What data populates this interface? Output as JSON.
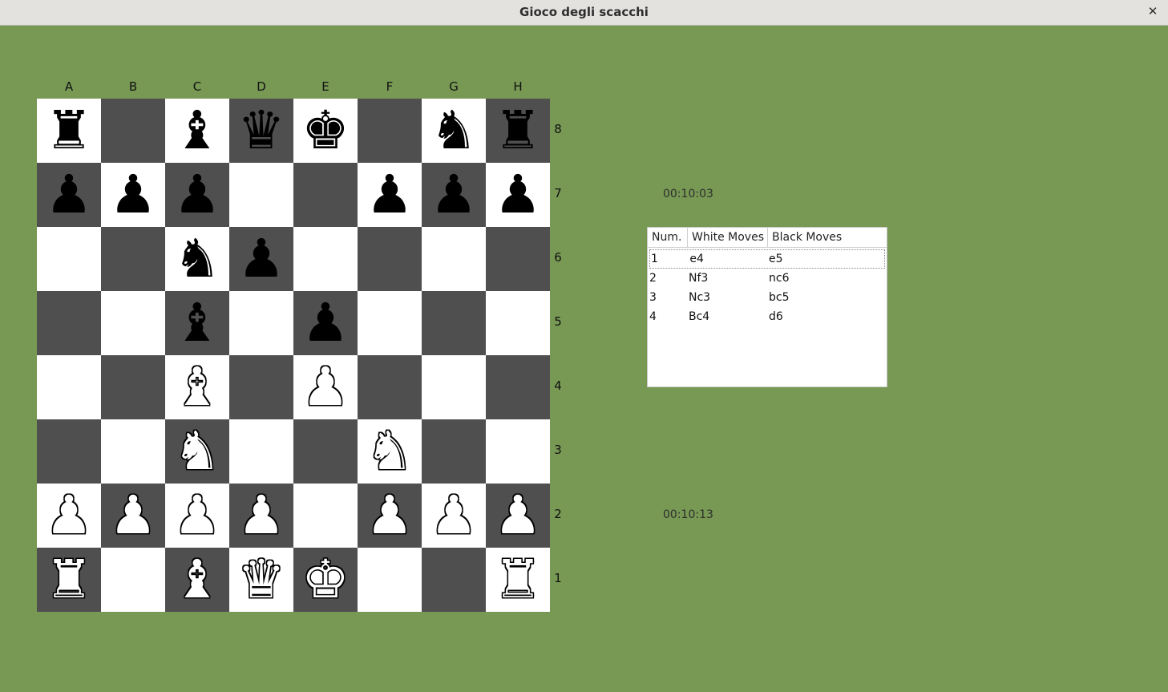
{
  "window": {
    "title": "Gioco degli scacchi",
    "close_glyph": "✕"
  },
  "files": [
    "A",
    "B",
    "C",
    "D",
    "E",
    "F",
    "G",
    "H"
  ],
  "ranks": [
    "8",
    "7",
    "6",
    "5",
    "4",
    "3",
    "2",
    "1"
  ],
  "board": [
    [
      "br",
      "",
      "bb",
      "bq",
      "bk",
      "",
      "bn",
      "br"
    ],
    [
      "bp",
      "bp",
      "bp",
      "",
      "",
      "bp",
      "bp",
      "bp"
    ],
    [
      "",
      "",
      "bn",
      "bp",
      "",
      "",
      "",
      ""
    ],
    [
      "",
      "",
      "bb",
      "",
      "bp",
      "",
      "",
      ""
    ],
    [
      "",
      "",
      "wb",
      "",
      "wp",
      "",
      "",
      ""
    ],
    [
      "",
      "",
      "wn",
      "",
      "",
      "wn",
      "",
      ""
    ],
    [
      "wp",
      "wp",
      "wp",
      "wp",
      "",
      "wp",
      "wp",
      "wp"
    ],
    [
      "wr",
      "",
      "wb",
      "wq",
      "wk",
      "",
      "",
      "wr"
    ]
  ],
  "piece_glyphs": {
    "k": "♚",
    "q": "♛",
    "r": "♜",
    "b": "♝",
    "n": "♞",
    "p": "♟"
  },
  "colors": {
    "background": "#779954",
    "light_square": "#ffffff",
    "dark_square": "#4f4f4f"
  },
  "timers": {
    "black": "00:10:03",
    "white": "00:10:13"
  },
  "moves_table": {
    "headers": [
      "Num.",
      "White Moves",
      "Black Moves"
    ],
    "rows": [
      [
        "1",
        "e4",
        "e5"
      ],
      [
        "2",
        "Nf3",
        "nc6"
      ],
      [
        "3",
        "Nc3",
        "bc5"
      ],
      [
        "4",
        "Bc4",
        "d6"
      ]
    ]
  }
}
